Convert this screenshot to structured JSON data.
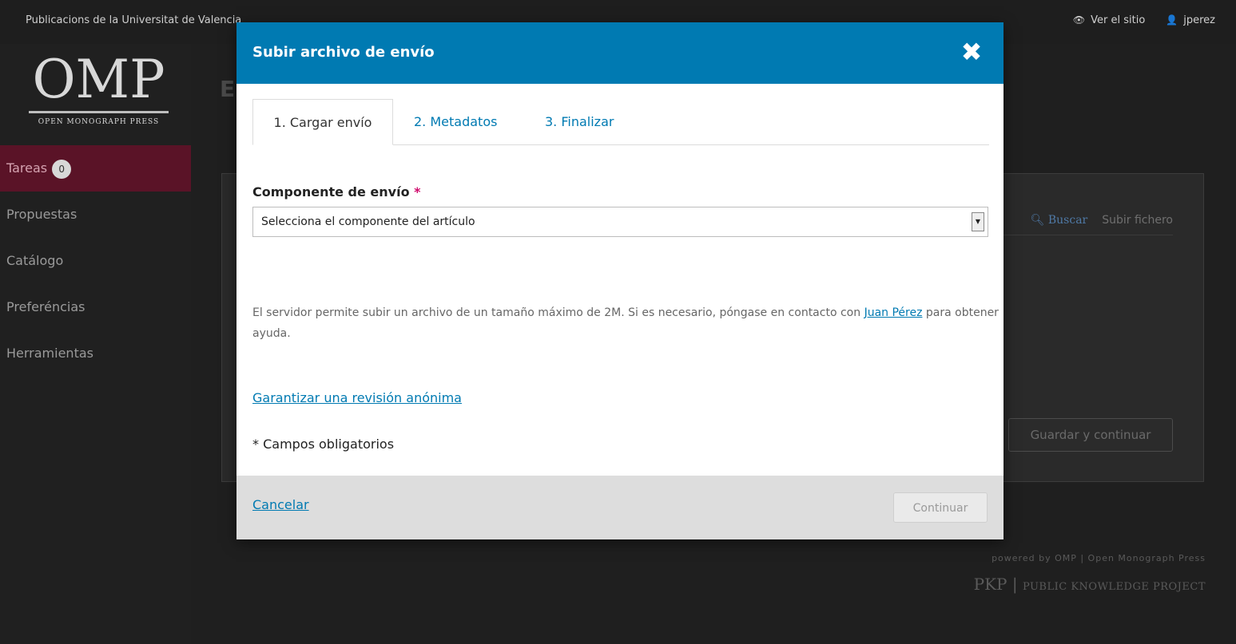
{
  "topbar": {
    "site_name": "Publicacions de la Universitat de Valencia",
    "view_site": "Ver el sitio",
    "username": "jperez"
  },
  "sidebar": {
    "logo_main": "OMP",
    "logo_sub": "OPEN MONOGRAPH PRESS",
    "items": [
      {
        "label": "Tareas",
        "badge": "0"
      },
      {
        "label": "Propuestas"
      },
      {
        "label": "Catálogo"
      },
      {
        "label": "Preferéncias"
      },
      {
        "label": "Herramientas"
      }
    ]
  },
  "background": {
    "title_initial": "E",
    "search_link": "Buscar",
    "upload_link": "Subir fichero",
    "save_button": "Guardar y continuar",
    "powered_by": "powered by OMP | Open Monograph Press",
    "pkp_short": "PKP",
    "pkp_long": "PUBLIC KNOWLEDGE PROJECT"
  },
  "modal": {
    "title": "Subir archivo de envío",
    "tabs": [
      {
        "label": "1. Cargar envío"
      },
      {
        "label": "2. Metadatos"
      },
      {
        "label": "3. Finalizar"
      }
    ],
    "component_label": "Componente de envío",
    "required_star": "*",
    "select_value": "Selecciona el componente del artículo",
    "help_text_before": "El servidor permite subir un archivo de un tamaño máximo de 2M. Si es necesario, póngase en contacto con ",
    "help_contact": "Juan Pérez",
    "help_text_after": " para obtener ayuda.",
    "anon_review_link": "Garantizar una revisión anónima",
    "required_note": "* Campos obligatorios",
    "cancel_link": "Cancelar",
    "continue_button": "Continuar"
  },
  "colors": {
    "accent": "#007ab2",
    "required": "#d00a6c"
  }
}
